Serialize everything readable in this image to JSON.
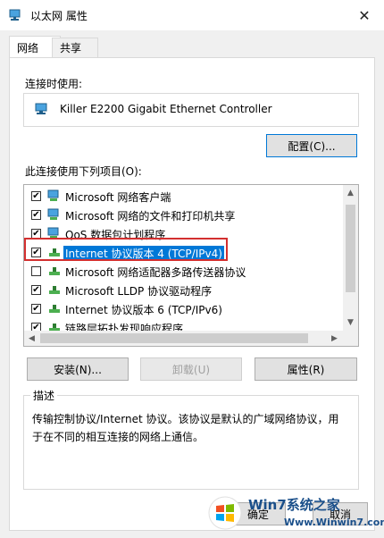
{
  "window": {
    "title": "以太网 属性",
    "close_glyph": "✕"
  },
  "tabs": [
    {
      "label": "网络",
      "active": true
    },
    {
      "label": "共享",
      "active": false
    }
  ],
  "connect_using": {
    "label": "连接时使用:",
    "adapter": "Killer E2200 Gigabit Ethernet Controller",
    "configure_button": "配置(C)..."
  },
  "items_section": {
    "label": "此连接使用下列项目(O):"
  },
  "items": [
    {
      "label": "Microsoft 网络客户端",
      "checked": true,
      "icon": "network-client-icon"
    },
    {
      "label": "Microsoft 网络的文件和打印机共享",
      "checked": true,
      "icon": "file-printer-sharing-icon"
    },
    {
      "label": "QoS 数据包计划程序",
      "checked": true,
      "icon": "qos-scheduler-icon"
    },
    {
      "label": "Internet 协议版本 4 (TCP/IPv4)",
      "checked": true,
      "selected": true,
      "icon": "protocol-icon"
    },
    {
      "label": "Microsoft 网络适配器多路传送器协议",
      "checked": false,
      "icon": "protocol-icon"
    },
    {
      "label": "Microsoft LLDP 协议驱动程序",
      "checked": true,
      "icon": "protocol-icon"
    },
    {
      "label": "Internet 协议版本 6 (TCP/IPv6)",
      "checked": true,
      "icon": "protocol-icon"
    },
    {
      "label": "链路层拓扑发现响应程序",
      "checked": true,
      "icon": "protocol-icon"
    }
  ],
  "buttons": {
    "install": "安装(N)...",
    "uninstall": "卸载(U)",
    "properties": "属性(R)",
    "ok": "确定",
    "cancel": "取消"
  },
  "description": {
    "legend": "描述",
    "text": "传输控制协议/Internet 协议。该协议是默认的广域网络协议，用于在不同的相互连接的网络上通信。"
  },
  "watermark": {
    "title": "Win7系统之家",
    "site": "Www.Winwin7.com"
  },
  "colors": {
    "selection": "#0078d7",
    "highlight_box": "#d32f2f",
    "checkmark": "#000000"
  }
}
